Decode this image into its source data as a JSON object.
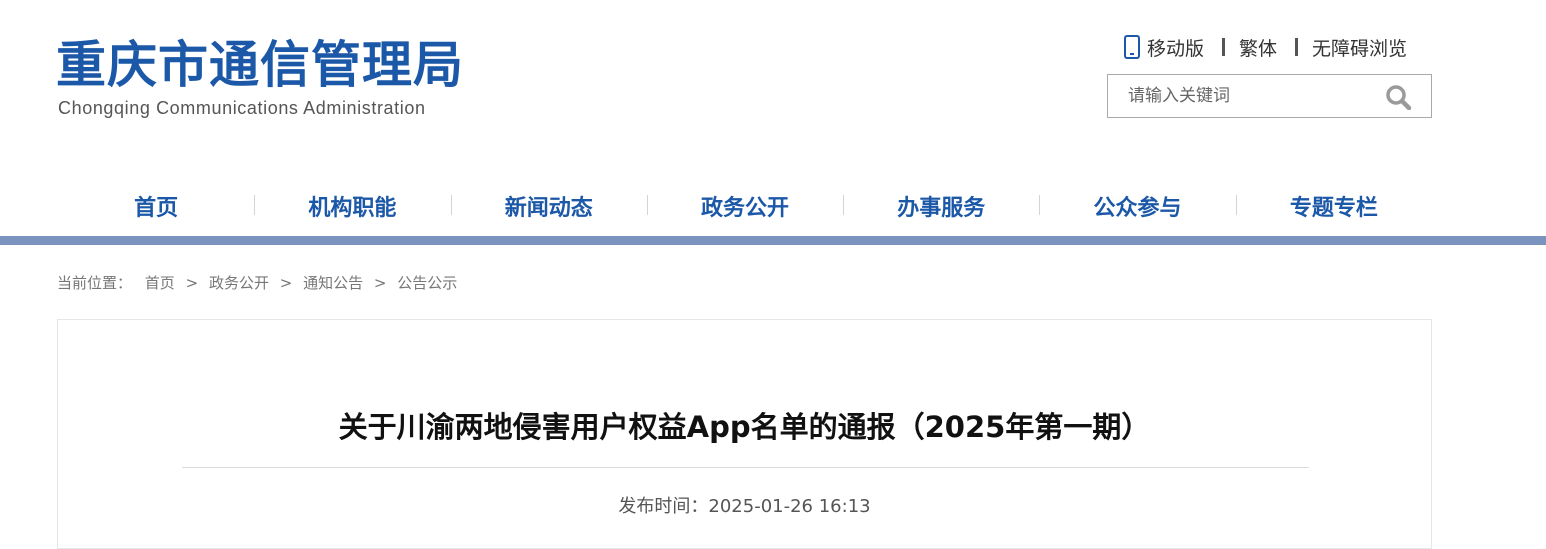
{
  "header": {
    "logo_cn": "重庆市通信管理局",
    "logo_en": "Chongqing Communications Administration",
    "links": {
      "mobile": "移动版",
      "traditional": "繁体",
      "accessible": "无障碍浏览"
    },
    "search": {
      "placeholder": "请输入关键词",
      "value": ""
    },
    "icons": [
      "mobile-phone-icon",
      "search-icon"
    ]
  },
  "nav": {
    "items": [
      "首页",
      "机构职能",
      "新闻动态",
      "政务公开",
      "办事服务",
      "公众参与",
      "专题专栏"
    ]
  },
  "breadcrumb": {
    "prefix": "当前位置：",
    "items": [
      "首页",
      "政务公开",
      "通知公告",
      "公告公示"
    ],
    "separator": ">"
  },
  "article": {
    "title": "关于川渝两地侵害用户权益App名单的通报（2025年第一期）",
    "pubtime_label": "发布时间：",
    "pubtime": "2025-01-26 16:13"
  },
  "colors": {
    "brand": "#1c58a8",
    "nav_bar": "#7b94bf"
  }
}
